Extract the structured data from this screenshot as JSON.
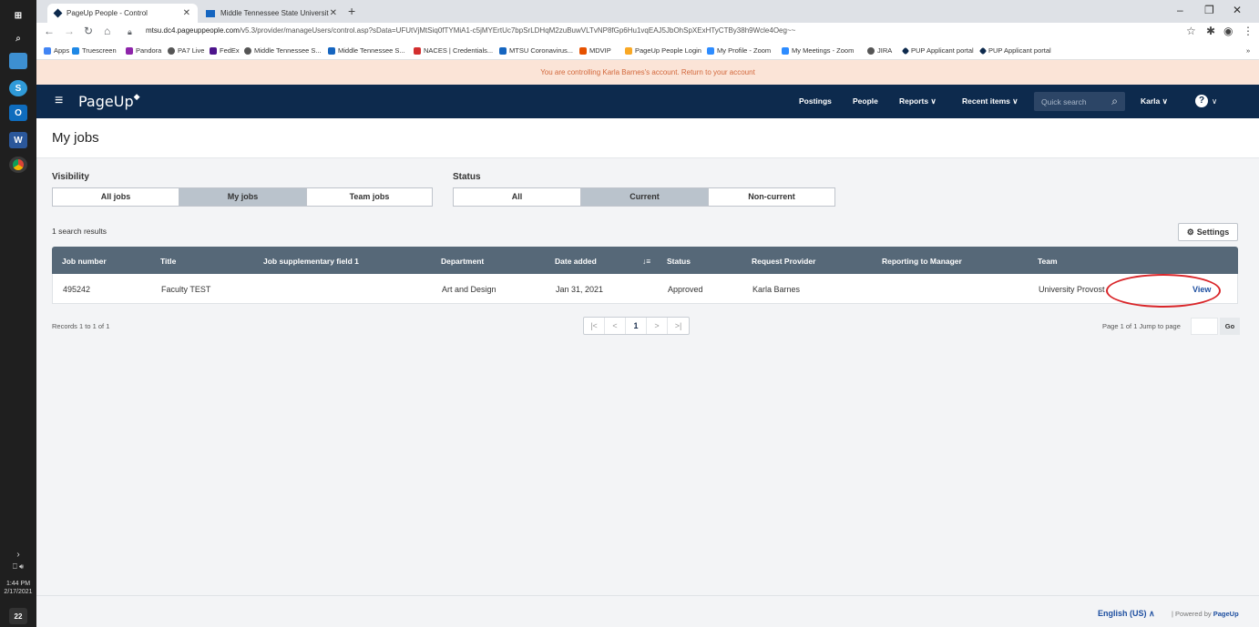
{
  "taskbar": {
    "time": "1:44 PM",
    "date": "2/17/2021",
    "notif_count": "22"
  },
  "browser": {
    "tabs": [
      {
        "label": "PageUp People - Control",
        "active": true
      },
      {
        "label": "Middle Tennessee State Universit",
        "active": false
      }
    ],
    "url_domain": "mtsu.dc4.pageuppeople.com",
    "url_path": "/v5.3/provider/manageUsers/control.asp?sData=UFUtVjMtSiq0fTYMiA1-c5jMYErtUc7bpSrLDHqM2zuBuwVLTvNP8fGp6Hu1vqEAJ5JbOhSpXExHTyCTBy38h9Wcle4Oeg~~",
    "bookmarks": [
      {
        "label": "Apps",
        "color": "#4285f4"
      },
      {
        "label": "Truescreen",
        "color": "#1e88e5"
      },
      {
        "label": "Pandora",
        "color": "#8e24aa"
      },
      {
        "label": "PA7 Live",
        "color": "#555555"
      },
      {
        "label": "FedEx",
        "color": "#4d148c"
      },
      {
        "label": "Middle Tennessee S...",
        "color": "#555555"
      },
      {
        "label": "Middle Tennessee S...",
        "color": "#1565c0"
      },
      {
        "label": "NACES | Credentials...",
        "color": "#d32f2f"
      },
      {
        "label": "MTSU Coronavirus...",
        "color": "#1565c0"
      },
      {
        "label": "MDVIP",
        "color": "#e65100"
      },
      {
        "label": "PageUp People Login",
        "color": "#f9a825"
      },
      {
        "label": "My Profile - Zoom",
        "color": "#2d8cff"
      },
      {
        "label": "My Meetings - Zoom",
        "color": "#2d8cff"
      },
      {
        "label": "JIRA",
        "color": "#555555"
      },
      {
        "label": "PUP Applicant portal",
        "color": "#0d2a4d"
      },
      {
        "label": "PUP Applicant portal",
        "color": "#0d2a4d"
      }
    ]
  },
  "banner": {
    "text": "You are controlling Karla Barnes's account. Return to your account"
  },
  "nav": {
    "logo": "PageUp",
    "links": [
      "Postings",
      "People",
      "Reports ∨",
      "Recent items ∨"
    ],
    "quick_search_placeholder": "Quick search",
    "user": "Karla ∨",
    "help": "?"
  },
  "page": {
    "title": "My jobs"
  },
  "filters": {
    "visibility_label": "Visibility",
    "visibility_options": [
      "All jobs",
      "My jobs",
      "Team jobs"
    ],
    "visibility_selected": "My jobs",
    "status_label": "Status",
    "status_options": [
      "All",
      "Current",
      "Non-current"
    ],
    "status_selected": "Current"
  },
  "results": {
    "count_text": "1 search results",
    "settings_label": "Settings"
  },
  "table": {
    "columns": [
      "Job number",
      "Title",
      "Job supplementary field 1",
      "Department",
      "Date added",
      "Status",
      "Request Provider",
      "Reporting to Manager",
      "Team"
    ],
    "sort_icon": "↓≡",
    "rows": [
      {
        "job_number": "495242",
        "title": "Faculty TEST",
        "supp_field": "",
        "department": "Art and Design",
        "date_added": "Jan 31, 2021",
        "status": "Approved",
        "request_provider": "Karla Barnes",
        "reporting_manager": "",
        "team": "University Provost",
        "action": "View"
      }
    ]
  },
  "pagination": {
    "records_text": "Records 1 to 1 of 1",
    "buttons": [
      "|<",
      "<",
      "1",
      ">",
      ">|"
    ],
    "current_page": "1",
    "page_info": "Page 1 of 1  Jump to page",
    "go_label": "Go"
  },
  "footer": {
    "language": "English (US) ∧",
    "powered_prefix": "| Powered by ",
    "powered_brand": "PageUp"
  },
  "colors": {
    "nav_bg": "#0d2a4d",
    "grid_header": "#566878",
    "link": "#1e4fa0",
    "highlight_ring": "#d9262a",
    "banner_bg": "#fbe4d7"
  }
}
